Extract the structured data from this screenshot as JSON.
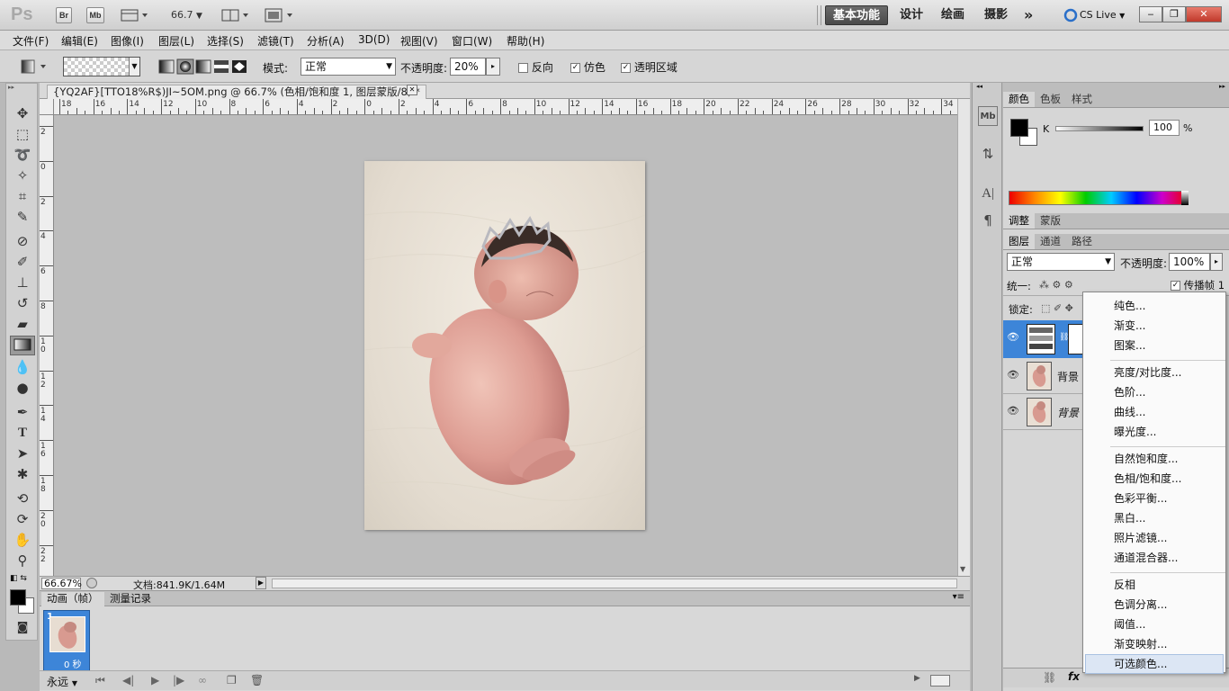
{
  "app": {
    "logo": "Ps",
    "bridge_btn": "Br",
    "minibridge_btn": "Mb",
    "zoom": "66.7",
    "workspaces": [
      "基本功能",
      "设计",
      "绘画",
      "摄影"
    ],
    "more": "»",
    "cslive": "CS Live"
  },
  "menu": [
    "文件(F)",
    "编辑(E)",
    "图像(I)",
    "图层(L)",
    "选择(S)",
    "滤镜(T)",
    "分析(A)",
    "3D(D)",
    "视图(V)",
    "窗口(W)",
    "帮助(H)"
  ],
  "options": {
    "mode_label": "模式:",
    "mode_value": "正常",
    "opacity_label": "不透明度:",
    "opacity_value": "20%",
    "reverse_label": "反向",
    "dither_label": "仿色",
    "transparency_label": "透明区域",
    "reverse_checked": false,
    "dither_checked": true,
    "transparency_checked": true
  },
  "document": {
    "tab_title": "{YQ2AF}[TTO18%R$)JI~5OM.png @ 66.7% (色相/饱和度 1, 图层蒙版/8) *",
    "close": "✕",
    "hruler_labels": [
      "18",
      "16",
      "14",
      "12",
      "10",
      "8",
      "6",
      "4",
      "2",
      "0",
      "2",
      "4",
      "6",
      "8",
      "10",
      "12",
      "14",
      "16",
      "18",
      "20",
      "22",
      "24",
      "26",
      "28",
      "30",
      "32",
      "34"
    ],
    "vruler_labels": [
      "2",
      "0",
      "2",
      "4",
      "6",
      "8",
      "1 0",
      "1 2",
      "1 4",
      "1 6",
      "1 8",
      "2 0",
      "2 2"
    ],
    "zoom_status": "66.67%",
    "doc_info": "文档:841.9K/1.64M"
  },
  "animation": {
    "tabs": [
      "动画（帧）",
      "测量记录"
    ],
    "frame_number": "1",
    "frame_delay": "0 秒",
    "loop": "永远"
  },
  "color_panel": {
    "tabs": [
      "颜色",
      "色板",
      "样式"
    ],
    "channel_label": "K",
    "value": "100",
    "unit": "%"
  },
  "adjust_panel": {
    "tabs": [
      "调整",
      "蒙版"
    ]
  },
  "layers_panel": {
    "tabs": [
      "图层",
      "通道",
      "路径"
    ],
    "blend_mode": "正常",
    "opacity_label": "不透明度:",
    "opacity_value": "100%",
    "unify_label": "统一:",
    "propagate_label": "传播帧 1",
    "lock_label": "锁定:",
    "layers": [
      {
        "name": "",
        "type": "adjustment"
      },
      {
        "name": "背景",
        "type": "image"
      },
      {
        "name": "背景",
        "type": "image-italic"
      }
    ]
  },
  "context_menu": {
    "groups": [
      [
        "纯色...",
        "渐变...",
        "图案..."
      ],
      [
        "亮度/对比度...",
        "色阶...",
        "曲线...",
        "曝光度..."
      ],
      [
        "自然饱和度...",
        "色相/饱和度...",
        "色彩平衡...",
        "黑白...",
        "照片滤镜...",
        "通道混合器..."
      ],
      [
        "反相",
        "色调分离...",
        "阈值...",
        "渐变映射...",
        "可选颜色..."
      ]
    ],
    "highlighted": "可选颜色..."
  },
  "colors": {
    "accent": "#3d85d8",
    "highlight": "#dce6f4"
  }
}
